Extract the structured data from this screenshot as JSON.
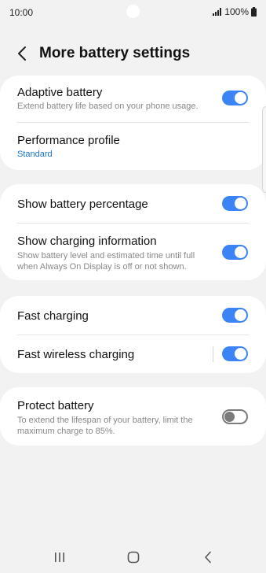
{
  "status_bar": {
    "time": "10:00",
    "battery_text": "100%"
  },
  "header": {
    "title": "More battery settings"
  },
  "cards": [
    {
      "rows": [
        {
          "title": "Adaptive battery",
          "subtitle": "Extend battery life based on your phone usage.",
          "toggle": true
        },
        {
          "title": "Performance profile",
          "value": "Standard"
        }
      ]
    },
    {
      "rows": [
        {
          "title": "Show battery percentage",
          "toggle": true
        },
        {
          "title": "Show charging information",
          "subtitle": "Show battery level and estimated time until full when Always On Display is off or not shown.",
          "toggle": true
        }
      ]
    },
    {
      "rows": [
        {
          "title": "Fast charging",
          "toggle": true
        },
        {
          "title": "Fast wireless charging",
          "toggle": true
        }
      ]
    },
    {
      "rows": [
        {
          "title": "Protect battery",
          "subtitle": "To extend the lifespan of your battery, limit the maximum charge to 85%.",
          "toggle": false
        }
      ]
    }
  ],
  "colors": {
    "accent": "#3c84f5",
    "link": "#1a73c8",
    "background": "#f2f2f2",
    "card": "#ffffff"
  },
  "icons": {
    "back": "chevron-left-icon",
    "signal": "signal-icon",
    "battery": "battery-full-icon",
    "nav_recents": "recent-apps-icon",
    "nav_home": "home-icon",
    "nav_back": "nav-back-icon"
  }
}
